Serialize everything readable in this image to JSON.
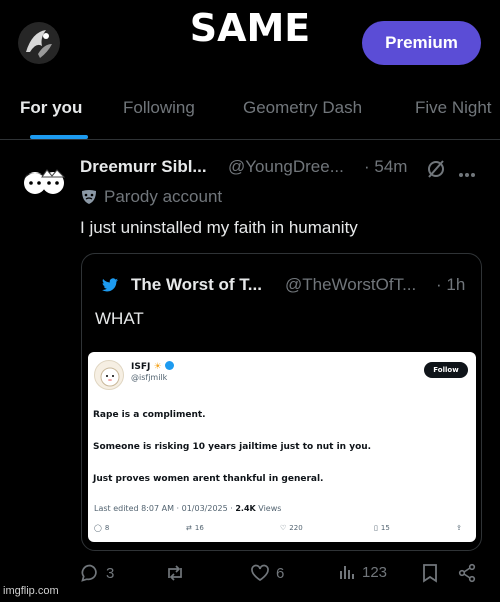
{
  "meme": {
    "caption": "SAME"
  },
  "header": {
    "premium_label": "Premium"
  },
  "tabs": [
    {
      "label": "For you",
      "active": true
    },
    {
      "label": "Following",
      "active": false
    },
    {
      "label": "Geometry Dash",
      "active": false
    },
    {
      "label": "Five Night",
      "active": false
    }
  ],
  "post": {
    "author_name": "Dreemurr Sibl...",
    "handle": "@YoungDree...",
    "time": "· 54m",
    "parody_label": "Parody account",
    "text": "I just uninstalled my faith in humanity",
    "quote": {
      "author_name": "The Worst of T...",
      "handle": "@TheWorstOfT...",
      "time": "· 1h",
      "text": "WHAT",
      "embedded": {
        "name": "ISFJ",
        "handle": "@isfjmilk",
        "follow_label": "Follow",
        "lines": [
          "Rape is a compliment.",
          "Someone is risking 10 years jailtime just to nut in you.",
          "Just proves women arent thankful in general."
        ],
        "meta_prefix": "Last edited 8:07 AM · 01/03/2025 · ",
        "views_count": "2.4K",
        "views_label": " Views",
        "replies": "8",
        "reposts": "16",
        "likes": "220",
        "bookmarks": "15"
      }
    },
    "actions": {
      "replies": "3",
      "likes": "6",
      "views": "123"
    }
  },
  "watermark": "imgflip.com",
  "colors": {
    "accent": "#1d9bf0",
    "premium": "#5b4dd6",
    "background": "#000000",
    "muted": "#71767b"
  }
}
